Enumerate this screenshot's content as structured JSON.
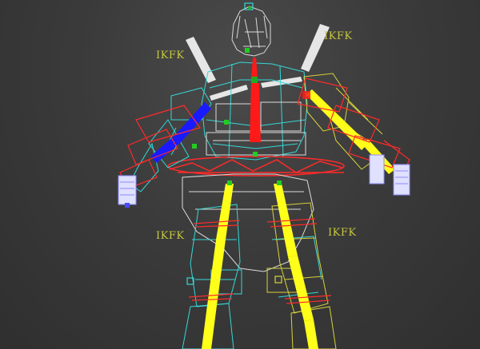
{
  "colors": {
    "background": "#3a3a3a",
    "mesh_cyan": "#36d7d7",
    "mesh_yellow": "#d7d23a",
    "mesh_white": "#dcdcdc",
    "bone_red": "#ff1a1a",
    "bone_blue": "#1a1aff",
    "bone_yellow": "#ffff1a",
    "bone_white": "#e6e6e6",
    "control_red": "#ff2a2a",
    "label_color": "#c8c83c"
  },
  "labels": {
    "ikfk_top_left": "IKFK",
    "ikfk_top_right": "IKFK",
    "ikfk_bottom_left": "IKFK",
    "ikfk_bottom_right": "IKFK"
  },
  "icons": {
    "ikfk_switch_shape": "ikfk-switch-icon",
    "spine_bone": "spine-bone-icon",
    "fist_left": "hand-icon",
    "fist_right": "hand-icon"
  }
}
